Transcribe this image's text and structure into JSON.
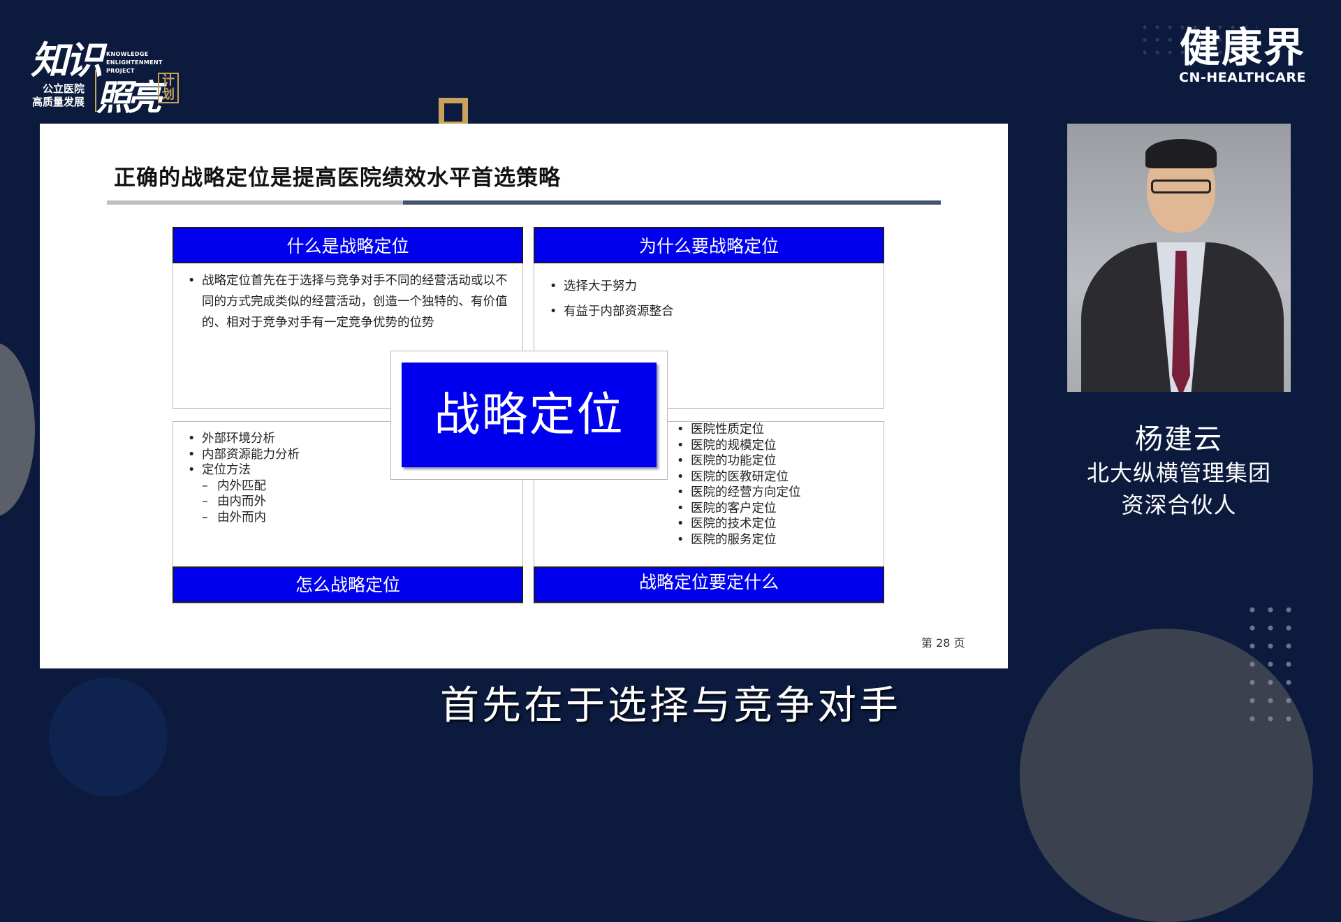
{
  "branding": {
    "left_logo": {
      "main": "知识",
      "english_line1": "KNOWLEDGE",
      "english_line2": "ENLIGHTENMENT PROJECT",
      "sub_line1": "公立医院",
      "sub_line2": "高质量发展",
      "main2": "照亮",
      "plan": "计划"
    },
    "right_logo": {
      "cn": "健康界",
      "en": "CN-HEALTHCARE"
    }
  },
  "slide": {
    "title": "正确的战略定位是提高医院绩效水平首选策略",
    "center_label": "战略定位",
    "quadrants": {
      "top_left": {
        "header": "什么是战略定位",
        "items": [
          "战略定位首先在于选择与竞争对手不同的经营活动或以不同的方式完成类似的经营活动，创造一个独特的、有价值的、相对于竞争对手有一定竞争优势的位势"
        ]
      },
      "top_right": {
        "header": "为什么要战略定位",
        "items": [
          "选择大于努力",
          "有益于内部资源整合"
        ]
      },
      "bottom_left": {
        "header": "怎么战略定位",
        "items": [
          "外部环境分析",
          "内部资源能力分析",
          "定位方法"
        ],
        "sub_items": [
          "内外匹配",
          "由内而外",
          "由外而内"
        ]
      },
      "bottom_right": {
        "header": "战略定位要定什么",
        "items": [
          "医院性质定位",
          "医院的规模定位",
          "医院的功能定位",
          "医院的医教研定位",
          "医院的经营方向定位",
          "医院的客户定位",
          "医院的技术定位",
          "医院的服务定位"
        ]
      }
    },
    "page_number": "第 28 页"
  },
  "speaker": {
    "name": "杨建云",
    "organization": "北大纵横管理集团",
    "role": "资深合伙人"
  },
  "caption": "首先在于选择与竞争对手",
  "colors": {
    "background": "#0b1a3d",
    "accent_blue": "#0000ee",
    "gold": "#c8a35c"
  }
}
